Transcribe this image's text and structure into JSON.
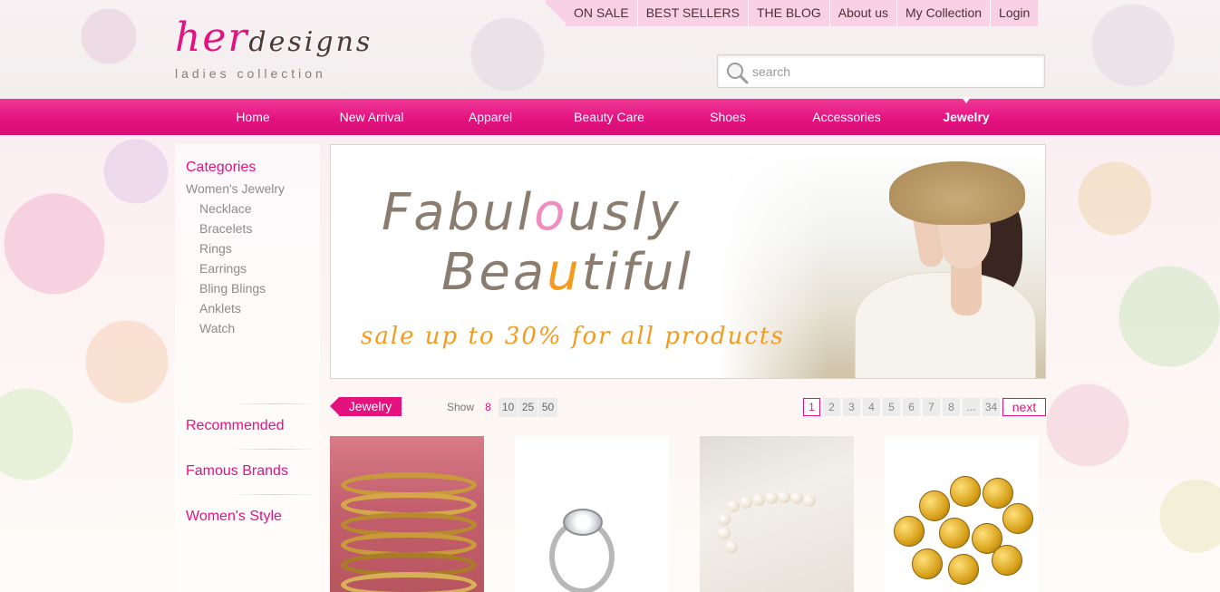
{
  "brand": {
    "name_part1": "her",
    "name_part2": "designs",
    "tagline": "ladies collection"
  },
  "topnav": [
    "ON SALE",
    "BEST SELLERS",
    "THE BLOG",
    "About us",
    "My Collection",
    "Login"
  ],
  "search": {
    "placeholder": "search"
  },
  "mainnav": {
    "items": [
      "Home",
      "New Arrival",
      "Apparel",
      "Beauty Care",
      "Shoes",
      "Accessories",
      "Jewelry"
    ],
    "active": "Jewelry"
  },
  "sidebar": {
    "categories_title": "Categories",
    "group": "Women's Jewelry",
    "items": [
      "Necklace",
      "Bracelets",
      "Rings",
      "Earrings",
      "Bling Blings",
      "Anklets",
      "Watch"
    ],
    "links": [
      "Recommended",
      "Famous Brands",
      "Women's Style"
    ]
  },
  "banner": {
    "line1_a": "Fabul",
    "line1_hl": "o",
    "line1_b": "usly",
    "line2_a": "Bea",
    "line2_hl": "u",
    "line2_b": "tiful",
    "sale": "sale up to 30% for all products"
  },
  "listing": {
    "tag": "Jewelry",
    "show_label": "Show",
    "show_options": [
      "8",
      "10",
      "25",
      "50"
    ],
    "show_selected": "8",
    "pages": [
      "1",
      "2",
      "3",
      "4",
      "5",
      "6",
      "7",
      "8",
      "...",
      "34"
    ],
    "current_page": "1",
    "next_label": "next"
  },
  "colors": {
    "accent": "#e4127f",
    "accent_light": "#f8d2e4",
    "sale_orange": "#f39a1f"
  },
  "products": [
    {
      "image": "gold-bangles"
    },
    {
      "image": "diamond-ring"
    },
    {
      "image": "pearl-bracelet"
    },
    {
      "image": "gold-coin-bracelet"
    }
  ]
}
